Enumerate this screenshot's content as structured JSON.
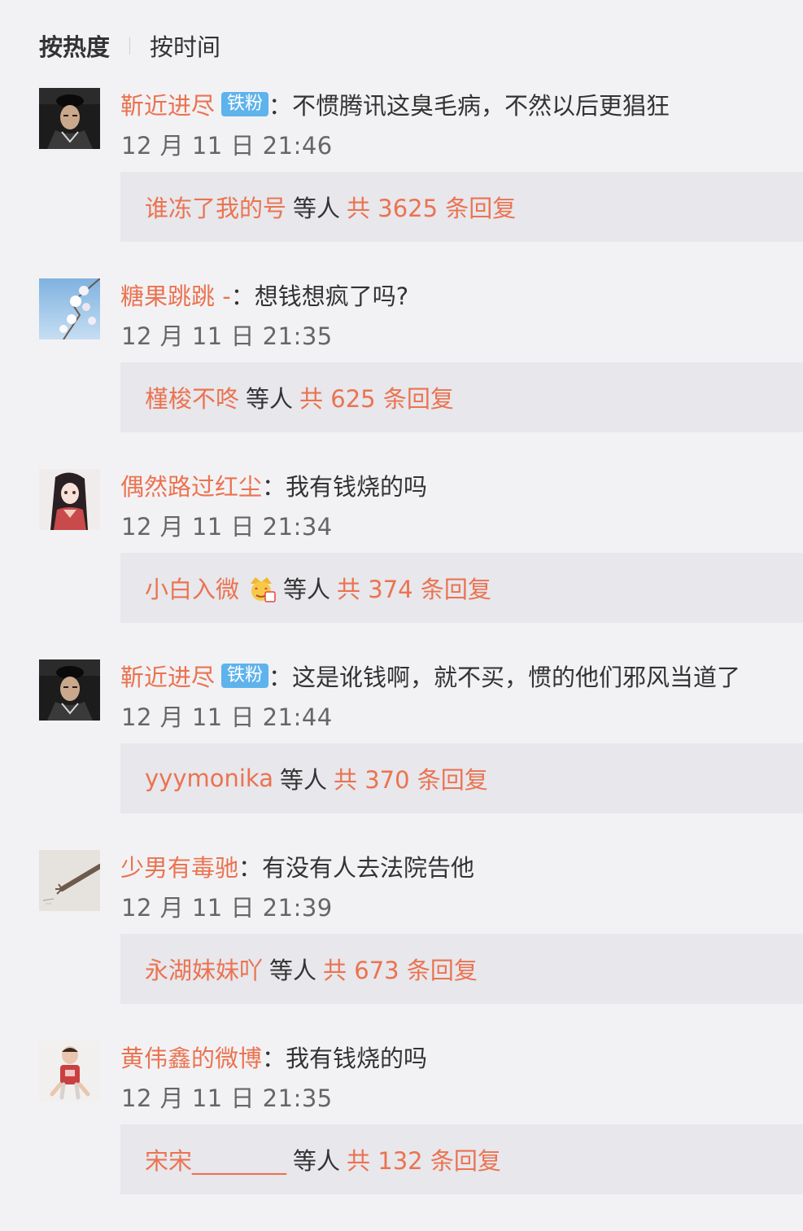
{
  "sort": {
    "hot_label": "按热度",
    "time_label": "按时间"
  },
  "comments": [
    {
      "user": "靳近进尽",
      "badge": "铁粉",
      "colon": "：",
      "text": "不惯腾讯这臭毛病，不然以后更猖狂",
      "time": "12 月 11 日 21:46",
      "reply_user": "谁冻了我的号",
      "reply_mid": "等人",
      "reply_count": "共 3625 条回复",
      "avatar_icon": "avatar-man-in-costume"
    },
    {
      "user": "糖果跳跳 -",
      "colon": "：",
      "text": "想钱想疯了吗?",
      "time": "12 月 11 日 21:35",
      "reply_user": "槿梭不咚",
      "reply_mid": "等人",
      "reply_count": "共 625 条回复",
      "avatar_icon": "avatar-blossom-sky"
    },
    {
      "user": "偶然路过红尘",
      "colon": "：",
      "text": "我有钱烧的吗",
      "time": "12 月 11 日 21:34",
      "reply_user": "小白入微",
      "reply_emoji": "crown-emoji",
      "reply_mid": "等人",
      "reply_count": "共 374 条回复",
      "avatar_icon": "avatar-anime-girl"
    },
    {
      "user": "靳近进尽",
      "badge": "铁粉",
      "colon": "：",
      "text": "这是讹钱啊，就不买，惯的他们邪风当道了",
      "time": "12 月 11 日 21:44",
      "reply_user": "yyymonika",
      "reply_mid": "等人",
      "reply_count": "共 370 条回复",
      "avatar_icon": "avatar-man-in-costume"
    },
    {
      "user": "少男有毒驰",
      "colon": "：",
      "text": "有没有人去法院告他",
      "time": "12 月 11 日 21:39",
      "reply_user": "永湖妹妹吖",
      "reply_mid": "等人",
      "reply_count": "共 673 条回复",
      "avatar_icon": "avatar-hand-sketch"
    },
    {
      "user": "黄伟鑫的微博",
      "colon": "：",
      "text": "我有钱烧的吗",
      "time": "12 月 11 日 21:35",
      "reply_user": "宋宋________",
      "reply_mid": "等人",
      "reply_count": "共 132 条回复",
      "avatar_icon": "avatar-boy-jersey"
    }
  ],
  "colors": {
    "background": "#f2f2f5",
    "reply_box": "#e7e7ec",
    "name_accent": "#eb7350",
    "badge": "#5fb3ec",
    "text": "#333333",
    "time": "#666666"
  }
}
